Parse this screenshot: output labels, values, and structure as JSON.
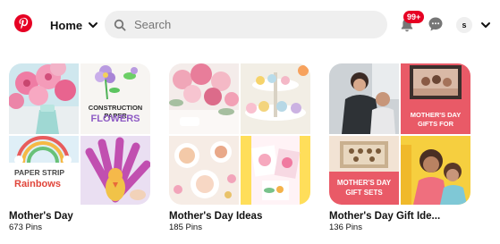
{
  "header": {
    "home_label": "Home",
    "search_placeholder": "Search",
    "notifications_badge": "99+",
    "avatar_initial": "s"
  },
  "colors": {
    "brand": "#e60023",
    "search_bg": "#efefef",
    "text": "#111111"
  },
  "icons": {
    "logo": "pinterest-logo",
    "home_dropdown": "chevron-down-icon",
    "search": "search-icon",
    "notifications": "bell-icon",
    "messages": "chat-bubble-icon",
    "account_menu": "chevron-down-icon"
  },
  "boards": [
    {
      "title": "Mother's Day",
      "pin_count": "673 Pins",
      "cover_text": {
        "top_right": "CONSTRUCTION PAPER",
        "top_right_accent": "FLOWERS",
        "bottom_left": "PAPER STRIP",
        "bottom_left_accent": "Rainbows"
      }
    },
    {
      "title": "Mother's Day Ideas",
      "pin_count": "185 Pins",
      "cover_text": {}
    },
    {
      "title": "Mother's Day Gift Ide...",
      "pin_count": "136 Pins",
      "cover_text": {
        "top_right": "MOTHER'S DAY GIFTS FOR",
        "bottom_left": "MOTHER'S DAY GIFT SETS"
      }
    }
  ]
}
